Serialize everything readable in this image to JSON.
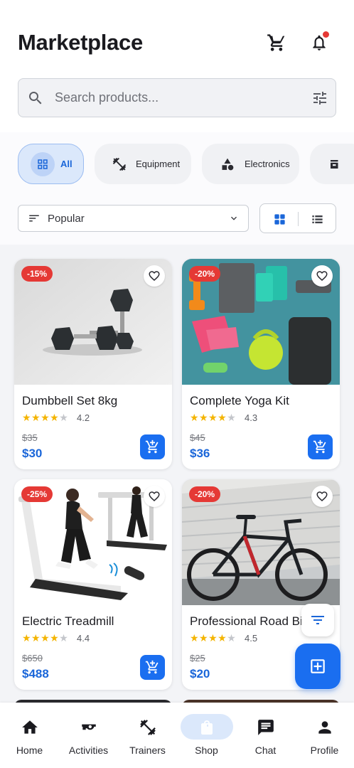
{
  "header": {
    "title": "Marketplace",
    "cart_icon": "cart-icon",
    "bell_icon": "bell-icon"
  },
  "search": {
    "placeholder": "Search products...",
    "filter_icon": "tune-icon"
  },
  "categories": [
    {
      "label": "All",
      "icon": "grid-icon",
      "active": true
    },
    {
      "label": "Equipment",
      "icon": "dumbbell-icon",
      "active": false
    },
    {
      "label": "Electronics",
      "icon": "shapes-icon",
      "active": false
    }
  ],
  "sort": {
    "label": "Popular"
  },
  "view_toggle": {
    "grid_icon": "grid-view-icon",
    "list_icon": "list-view-icon",
    "selected": "grid"
  },
  "products": [
    {
      "name": "Dumbbell Set 8kg",
      "discount": "-15%",
      "rating_value": 4.2,
      "rating": "4.2",
      "old_price": "$35",
      "price": "$30"
    },
    {
      "name": "Complete Yoga Kit",
      "discount": "-20%",
      "rating_value": 4.3,
      "rating": "4.3",
      "old_price": "$45",
      "price": "$36"
    },
    {
      "name": "Electric Treadmill",
      "discount": "-25%",
      "rating_value": 4.4,
      "rating": "4.4",
      "old_price": "$650",
      "price": "$488"
    },
    {
      "name": "Professional Road Bi",
      "discount": "-20%",
      "rating_value": 4.5,
      "rating": "4.5",
      "old_price": "$25",
      "price": "$20"
    }
  ],
  "nav": [
    {
      "label": "Home",
      "icon": "home-icon"
    },
    {
      "label": "Activities",
      "icon": "activities-icon"
    },
    {
      "label": "Trainers",
      "icon": "trainers-icon"
    },
    {
      "label": "Shop",
      "icon": "shop-icon",
      "active": true
    },
    {
      "label": "Chat",
      "icon": "chat-icon"
    },
    {
      "label": "Profile",
      "icon": "profile-icon"
    }
  ],
  "colors": {
    "accent": "#1a6ef0",
    "badge": "#e53935",
    "star": "#f4b400",
    "chip_active_bg": "#dbe8fb"
  }
}
